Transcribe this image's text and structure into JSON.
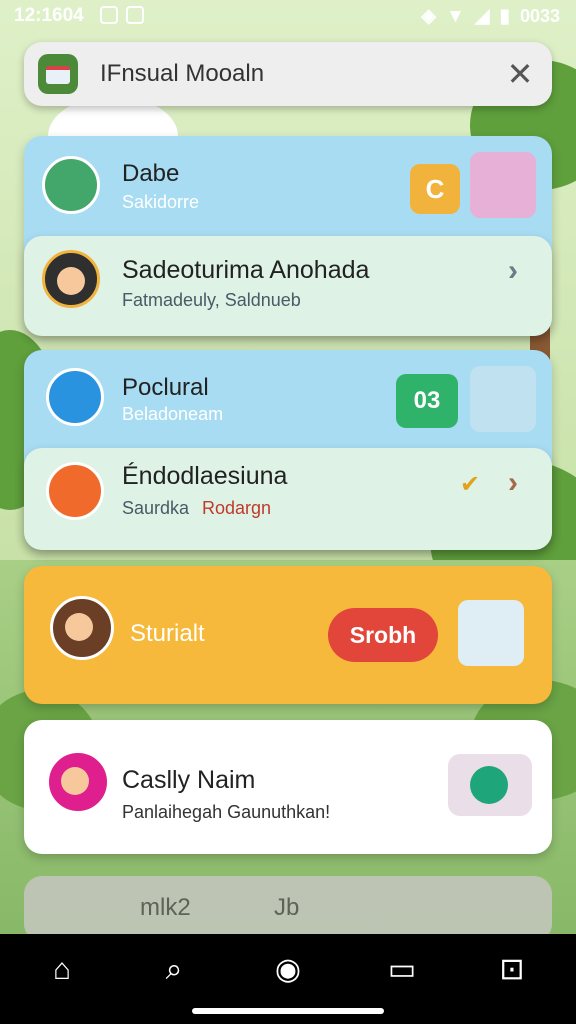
{
  "status": {
    "time": "12:1604",
    "battery": "0033"
  },
  "search": {
    "title": "IFnsual Mooaln",
    "close_icon": "close-icon"
  },
  "notifications": [
    {
      "title": "Dabe",
      "subtitle": "Sakidorre",
      "badge": "C",
      "badge_color": "#f2b33d"
    },
    {
      "title": "Sadeoturima Anohada",
      "subtitle": "Fatmadeuly, Saldnueb"
    },
    {
      "title": "Poclural",
      "subtitle": "Beladoneam",
      "badge": "03",
      "badge_color": "#2fb36a"
    },
    {
      "title": "Éndodlaesiuna",
      "subtitle_a": "Saurdka",
      "subtitle_b": "Rodargn"
    },
    {
      "title": "Sturialt",
      "button": "Srobh",
      "bg": "#f6b93b"
    },
    {
      "title": "Caslly Naim",
      "subtitle": "Panlaihegah Gaunuthkan!"
    }
  ],
  "ghost_bar": {
    "label_a": "mlk2",
    "label_b": "Jb"
  },
  "nav": [
    "home-icon",
    "search-icon",
    "profile-icon",
    "window-icon",
    "lock-icon"
  ]
}
